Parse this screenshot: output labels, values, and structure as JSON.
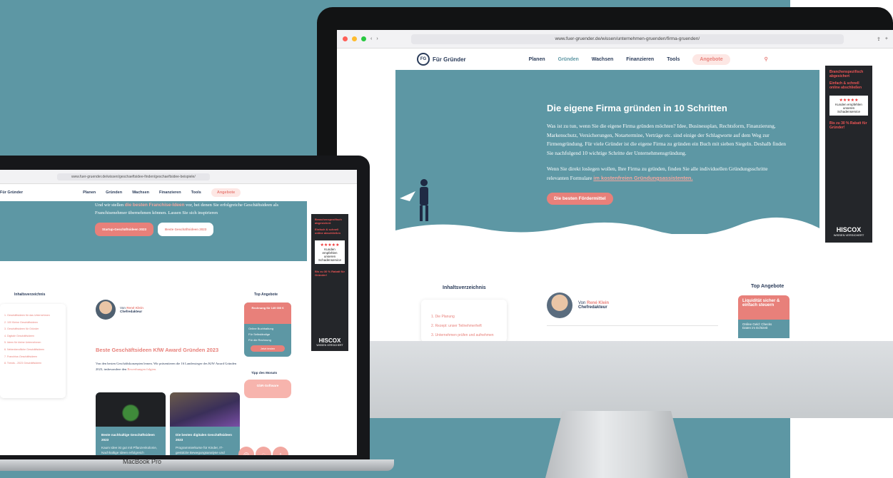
{
  "imac": {
    "url": "www.fuer-gruender.de/wissen/unternehmen-gruenden/firma-gruenden/",
    "brand": "Für Gründer",
    "brand_short": "FG",
    "nav": [
      "Planen",
      "Gründen",
      "Wachsen",
      "Finanzieren",
      "Tools",
      "Angebote"
    ],
    "hero_title": "Die eigene Firma gründen in 10 Schritten",
    "hero_p1": "Was ist zu tun, wenn Sie die eigene Firma gründen möchten? Idee, Businessplan, Rechtsform, Finanzierung, Markenschutz, Versicherungen, Notartermine, Verträge etc. sind einige der Schlagworte auf dem Weg zur Firmengründung. Für viele Gründer ist die eigene Firma zu gründen ein Buch mit sieben Siegeln. Deshalb finden Sie nachfolgend 10 wichtige Schritte der Unternehmensgründung.",
    "hero_p2": "Wenn Sie direkt loslegen wollen, Ihre Firma zu gründen, finden Sie alle individuellen Gründungsschritte relevanten Formulare",
    "hero_p2_link": "im kostenfreien Gründungsassistenten.",
    "hero_button": "Die besten Fördermittel",
    "toc_title": "Inhaltsverzeichnis",
    "toc_items": [
      "1. Die Planung",
      "2. Rezept: unser Teilnehmerheft",
      "3. Unternehmen prüfen und aufnehmen"
    ],
    "author_prefix": "Von",
    "author_name": "René Klein",
    "author_role": "Chefredakteur",
    "top_title": "Top Angebote",
    "offer_title": "Liquidität sicher & einfach steuern",
    "offer_items": [
      "Online Geld: Checks",
      "Daten im Echtzeit"
    ],
    "ad": {
      "l1": "Branchenspezifisch abgesichert",
      "l2": "Einfach & schnell online abschließen",
      "l3": "Kunden empfehlen unseren Schadenservice",
      "l4": "Bis zu 30 % Rabatt für Gründer!",
      "brand": "HISCOX",
      "claim": "WISSEN VERSICHERT"
    }
  },
  "macbook": {
    "label": "MacBook Pro",
    "url": "www.fuer-gruender.de/wissen/geschaeftsidee-finden/geschaeftsidee-beispiele/",
    "brand": "Für Gründer",
    "nav": [
      "Planen",
      "Gründen",
      "Wachsen",
      "Finanzieren",
      "Tools",
      "Angebote"
    ],
    "hero_t1": "Und wir stellen",
    "hero_link": "die besten Franchise-Ideen",
    "hero_t2": "vor, bei denen Sie erfolgreiche Geschäftsideen als Franchisenehmer übernehmen können. Lassen Sie sich inspirieren",
    "btn1": "Startup-Geschäftsideen 2023",
    "btn2": "Beste Geschäftsideen 2023",
    "toc_title": "Inhaltsverzeichnis",
    "toc_items": [
      "1. Geschäftsideen für das Unternehmen",
      "2. 100 Kleine Geschäftsideen",
      "3. Geschäftsideen für Gründer",
      "4. Digitale Geschäftsideen",
      "5. Ideen für kleine Unternehmen",
      "6. Nebenberufliche Geschäftsideen",
      "7. Franchise-Geschäftsideen",
      "8. Trends - 2023 Geschäftsideen"
    ],
    "author_prefix": "Von",
    "author_name": "René Klein",
    "author_role": "Chefredakteur",
    "h2": "Beste Geschäftsideen KfW Award Gründen 2023",
    "p": "Von den besten Geschäftskonzepten lernen. Wir präsentieren die 16 Landessieger des KfW Award Gründen 2023, insbesondere den",
    "p_link": "Bewerbungen folgten.",
    "top_title": "Top Angebote",
    "offer_head": "Rechnung für 149 000 €",
    "offer_items": [
      "Online Buchhaltung",
      "Für Selbständige",
      "Für die Rechnung"
    ],
    "offer_btn": "Jetzt testen",
    "tipp_title": "Tipp des Monats",
    "tipp": "GbR-Software",
    "card1_title": "Beste nachhaltige Geschäftsideen 2023",
    "card1_text": "Kaum Idee ist gut mit Pflanzenkolonie, Nachhaltige Ideen erfolgreich",
    "card2_title": "Die besten digitalen Geschäftsideen 2023",
    "card2_text": "Programmierkurse für Kinder, IT-gestützte Bewegungsanalyse und Pflegedienstbörsen"
  },
  "colors": {
    "teal": "#5d97a4",
    "coral": "#e8807a",
    "navy": "#2b3c5a"
  }
}
